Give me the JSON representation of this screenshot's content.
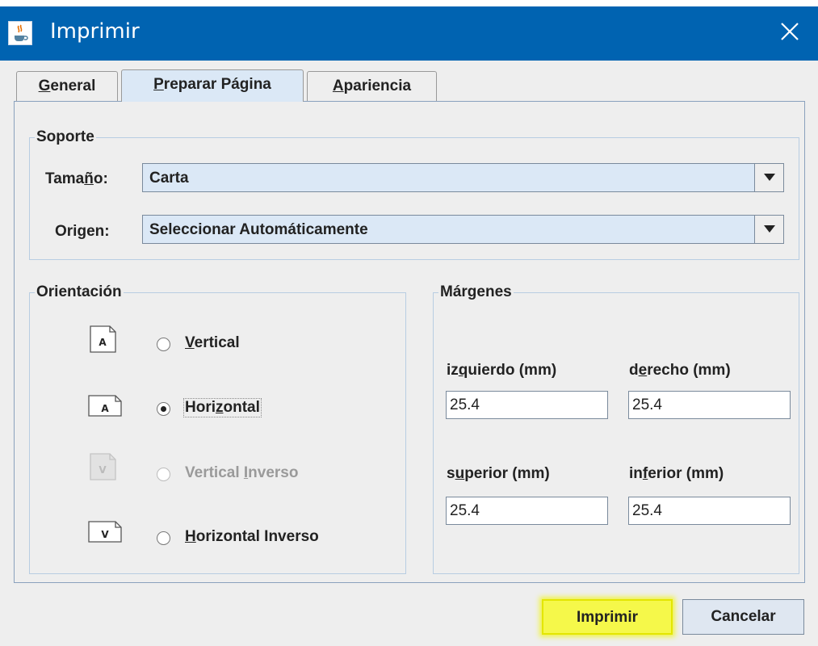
{
  "window": {
    "title": "Imprimir"
  },
  "tabs": [
    {
      "label": "General",
      "mnemonic_index": 0
    },
    {
      "label": "Preparar Página",
      "mnemonic_index": 0
    },
    {
      "label": "Apariencia",
      "mnemonic_index": 0
    }
  ],
  "active_tab": "Preparar Página",
  "soporte": {
    "legend": "Soporte",
    "size_label": "Tamaño:",
    "size_value": "Carta",
    "source_label": "Origen:",
    "source_value": "Seleccionar Automáticamente"
  },
  "orientacion": {
    "legend": "Orientación",
    "options": [
      {
        "label": "Vertical",
        "selected": false,
        "enabled": true
      },
      {
        "label": "Horizontal",
        "selected": true,
        "enabled": true
      },
      {
        "label": "Vertical Inverso",
        "selected": false,
        "enabled": false
      },
      {
        "label": "Horizontal Inverso",
        "selected": false,
        "enabled": true
      }
    ],
    "icon_letters": [
      "A",
      "A",
      "V",
      "V"
    ]
  },
  "margenes": {
    "legend": "Márgenes",
    "left_label": "izquierdo (mm)",
    "left_value": "25.4",
    "right_label": "derecho (mm)",
    "right_value": "25.4",
    "top_label": "superior (mm)",
    "top_value": "25.4",
    "bottom_label": "inferior (mm)",
    "bottom_value": "25.4"
  },
  "buttons": {
    "print": "Imprimir",
    "cancel": "Cancelar"
  },
  "colors": {
    "titlebar": "#0063b1",
    "highlight": "#f5f84a",
    "dialog_bg": "#eeeeee"
  }
}
